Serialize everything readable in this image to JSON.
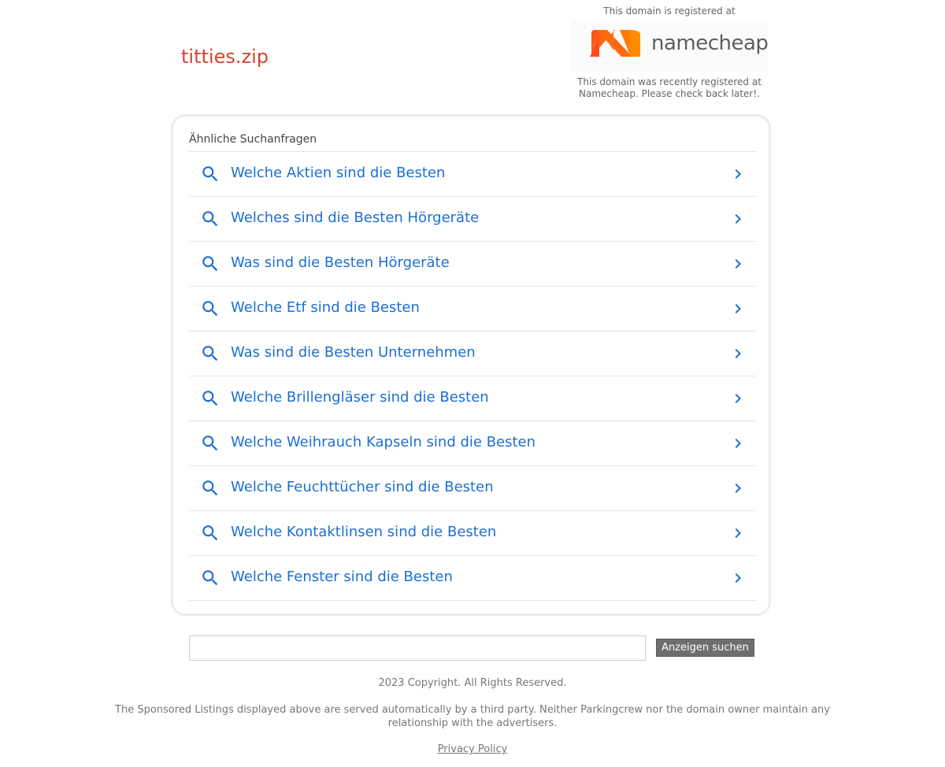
{
  "domain": "titties.zip",
  "registrar": {
    "top_text": "This domain is registered at",
    "logo_text": "namecheap",
    "logo_color": "#ff5f00",
    "note": "This domain was recently registered at Namecheap. Please check back later!."
  },
  "results": {
    "heading": "Ähnliche Suchanfragen",
    "items": [
      {
        "label": "Welche Aktien sind die Besten"
      },
      {
        "label": "Welches sind die Besten Hörgeräte"
      },
      {
        "label": "Was sind die Besten Hörgeräte"
      },
      {
        "label": "Welche Etf sind die Besten"
      },
      {
        "label": "Was sind die Besten Unternehmen"
      },
      {
        "label": "Welche Brillengläser sind die Besten"
      },
      {
        "label": "Welche Weihrauch Kapseln sind die Besten"
      },
      {
        "label": "Welche Feuchttücher sind die Besten"
      },
      {
        "label": "Welche Kontaktlinsen sind die Besten"
      },
      {
        "label": "Welche Fenster sind die Besten"
      }
    ],
    "link_color": "#1c6fd1",
    "icons": [
      "search-icon",
      "chevron-right-icon"
    ]
  },
  "search": {
    "value": "",
    "button_label": "Anzeigen suchen"
  },
  "footer": {
    "copyright": "2023 Copyright. All Rights Reserved.",
    "disclaimer": "The Sponsored Listings displayed above are served automatically by a third party. Neither Parkingcrew nor the domain owner maintain any relationship with the advertisers.",
    "privacy_label": "Privacy Policy"
  }
}
